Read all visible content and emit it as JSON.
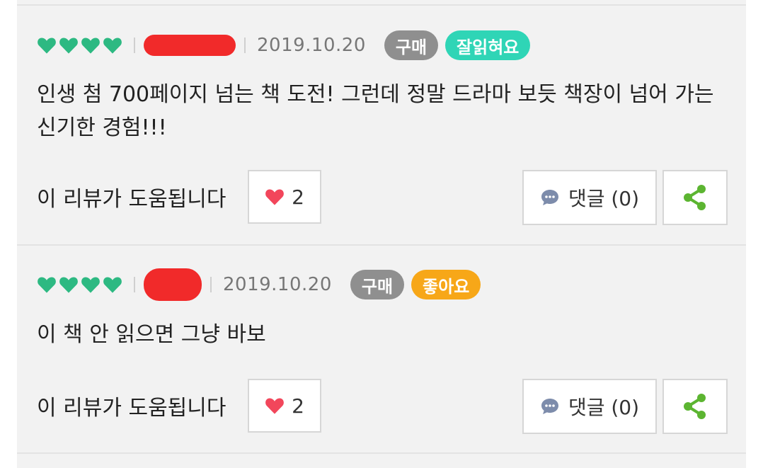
{
  "reviews": [
    {
      "date": "2019.10.20",
      "purchase_tag": "구매",
      "rating_tag": "잘읽혀요",
      "rating_color": "#2fd5b6",
      "hearts": 4,
      "text": "인생 첨 700페이지 넘는 책 도전! 그런데 정말 드라마 보듯 책장이 넘어 가는 신기한 경험!!!",
      "helpful_label": "이 리뷰가 도움됩니다",
      "like_count": "2",
      "comment_label": "댓글 (0)"
    },
    {
      "date": "2019.10.20",
      "purchase_tag": "구매",
      "rating_tag": "좋아요",
      "rating_color": "#f7a718",
      "hearts": 4,
      "text": "이 책 안 읽으면 그냥 바보",
      "helpful_label": "이 리뷰가 도움됩니다",
      "like_count": "2",
      "comment_label": "댓글 (0)"
    }
  ],
  "colors": {
    "heart_rating": "#2db982",
    "like_heart": "#f2465b",
    "share": "#5cb531",
    "comment_icon": "#7d8cab"
  },
  "icons": [
    "heart-rating-icon",
    "like-heart-icon",
    "comment-icon",
    "share-icon"
  ]
}
